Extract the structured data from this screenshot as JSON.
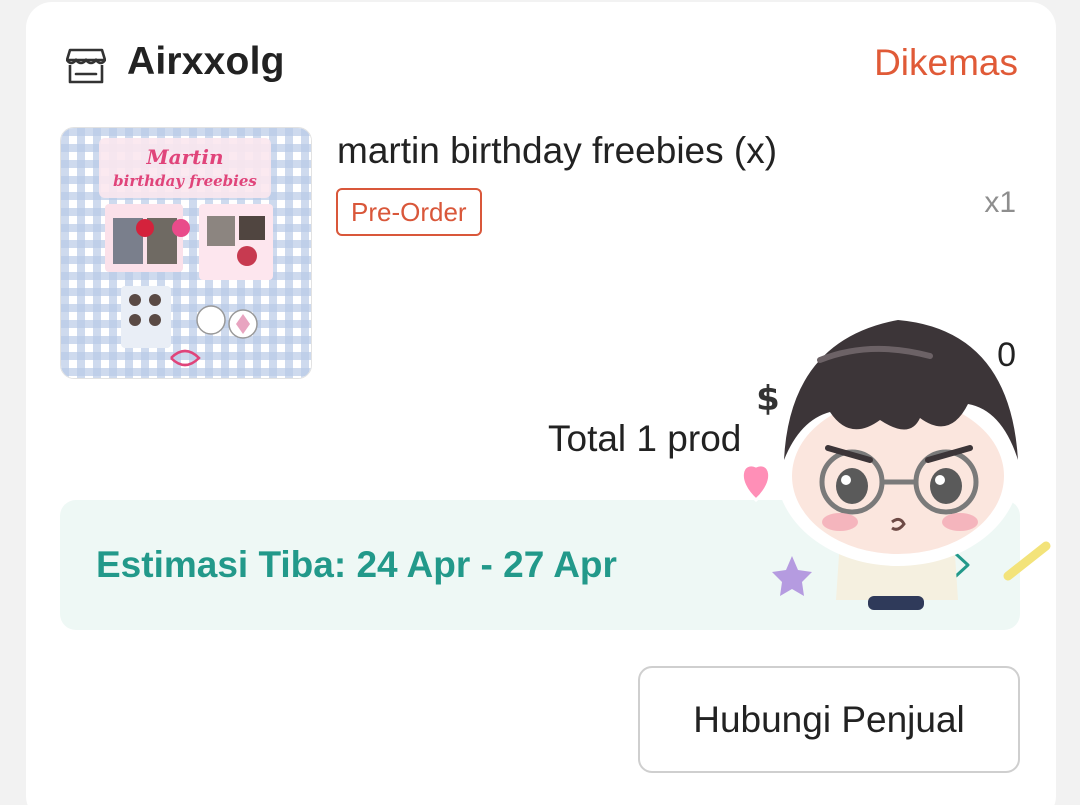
{
  "shop": {
    "name": "Airxxolg",
    "icon": "store-icon",
    "status": "Dikemas"
  },
  "product": {
    "title": "martin birthday freebies (x)",
    "badge": "Pre-Order",
    "quantity": "x1",
    "price_partial": "0",
    "thumbnail": {
      "title_line1": "Martin",
      "title_line2": "birthday freebies"
    }
  },
  "total": {
    "label": "Total 1 prod"
  },
  "estimate": {
    "text": "Estimasi Tiba: 24 Apr - 27 Apr",
    "icon": "chevron-right-icon"
  },
  "actions": {
    "contact_label": "Hubungi Penjual"
  },
  "colors": {
    "status": "#e05a37",
    "estimate_text": "#22998a",
    "estimate_bg": "#eef8f5",
    "badge": "#d9573a"
  }
}
